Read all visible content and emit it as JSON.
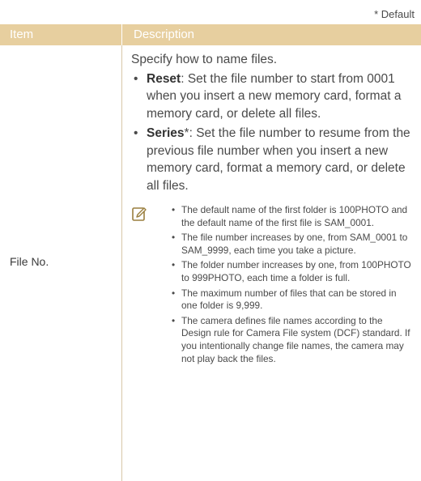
{
  "default_note": "* Default",
  "header": {
    "item": "Item",
    "description": "Description"
  },
  "row": {
    "item": "File No.",
    "intro": "Specify how to name files.",
    "options": [
      {
        "name": "Reset",
        "suffix": ":",
        "text": " Set the file number to start from 0001 when you insert a new memory card, format a memory card, or delete all files."
      },
      {
        "name": "Series",
        "suffix": "*:",
        "text": " Set the file number to resume from the previous file number when you insert a new memory card, format a memory card, or delete all files."
      }
    ],
    "note_icon": "note-pencil-icon",
    "notes": [
      "The default name of the first folder is 100PHOTO and the default name of the first file is SAM_0001.",
      "The file number increases by one, from SAM_0001 to SAM_9999, each time you take a picture.",
      "The folder number increases by one, from 100PHOTO to 999PHOTO, each time a folder is full.",
      "The maximum number of files that can be stored in one folder is 9,999.",
      "The camera defines file names according to the Design rule for Camera File system (DCF) standard. If you intentionally change file names, the camera may not play back the files."
    ]
  },
  "colors": {
    "header_bg": "#e7cf9f",
    "divider": "#d8c8a8",
    "text": "#4a4a4a",
    "icon": "#9a7f3f"
  }
}
